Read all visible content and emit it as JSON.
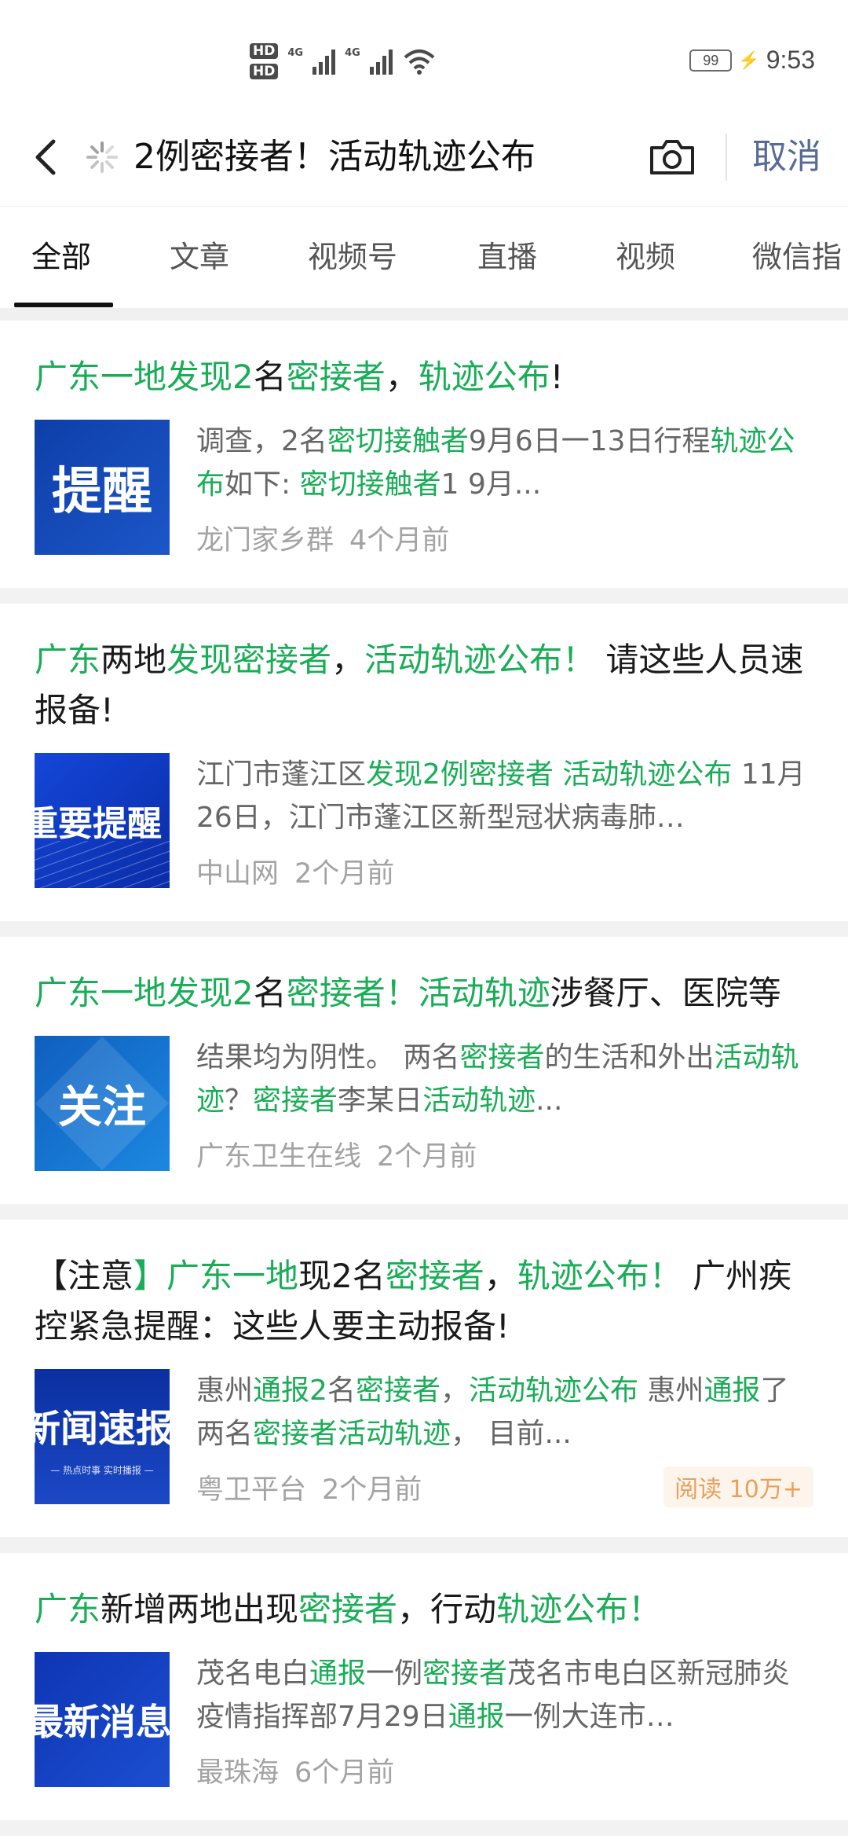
{
  "status": {
    "hd1": "HD",
    "hd2": "HD",
    "net1": "4G",
    "net2": "4G",
    "battery": "99",
    "time": "9:53"
  },
  "search": {
    "query": "2例密接者！活动轨迹公布",
    "cancel": "取消"
  },
  "tabs": [
    "全部",
    "文章",
    "视频号",
    "直播",
    "视频",
    "微信指"
  ],
  "colors": {
    "highlight": "#1aad57",
    "cancel": "#576b95",
    "read_badge": "#e7a05c"
  },
  "results": [
    {
      "title": [
        {
          "t": "广东一地发现2",
          "h": true
        },
        {
          "t": "名",
          "h": false
        },
        {
          "t": "密接者",
          "h": true
        },
        {
          "t": "，",
          "h": false
        },
        {
          "t": "轨迹公布",
          "h": true
        },
        {
          "t": "!",
          "h": false
        }
      ],
      "thumb_text": "提醒",
      "desc": [
        {
          "t": "调查，2名",
          "h": false
        },
        {
          "t": "密切接触者",
          "h": true
        },
        {
          "t": "9月6日一13日行程",
          "h": false
        },
        {
          "t": "轨迹公布",
          "h": true
        },
        {
          "t": "如下: ",
          "h": false
        },
        {
          "t": "密切接触者",
          "h": true
        },
        {
          "t": "1 9月...",
          "h": false
        }
      ],
      "source": "龙门家乡群",
      "ago": "4个月前"
    },
    {
      "title": [
        {
          "t": "广东",
          "h": true
        },
        {
          "t": "两地",
          "h": false
        },
        {
          "t": "发现密接者",
          "h": true
        },
        {
          "t": "，",
          "h": false
        },
        {
          "t": "活动轨迹公布！",
          "h": true
        },
        {
          "t": " 请这些人员速报备!",
          "h": false
        }
      ],
      "thumb_text": "重要提醒",
      "desc": [
        {
          "t": "江门市蓬江区",
          "h": false
        },
        {
          "t": "发现2例密接者 活动轨迹公布",
          "h": true
        },
        {
          "t": " 11月26日，江门市蓬江区新型冠状病毒肺…",
          "h": false
        }
      ],
      "source": "中山网",
      "ago": "2个月前"
    },
    {
      "title": [
        {
          "t": "广东一地发现2",
          "h": true
        },
        {
          "t": "名",
          "h": false
        },
        {
          "t": "密接者！活动轨迹",
          "h": true
        },
        {
          "t": "涉餐厅、医院等",
          "h": false
        }
      ],
      "thumb_text": "关注",
      "desc": [
        {
          "t": "结果均为阴性。 两名",
          "h": false
        },
        {
          "t": "密接者",
          "h": true
        },
        {
          "t": "的生活和外出",
          "h": false
        },
        {
          "t": "活动轨迹",
          "h": true
        },
        {
          "t": "？",
          "h": false
        },
        {
          "t": "密接者",
          "h": true
        },
        {
          "t": "李某日",
          "h": false
        },
        {
          "t": "活动轨迹",
          "h": true
        },
        {
          "t": "...",
          "h": false
        }
      ],
      "source": "广东卫生在线",
      "ago": "2个月前"
    },
    {
      "title": [
        {
          "t": "【注意",
          "h": false
        },
        {
          "t": "】广东一地",
          "h": true
        },
        {
          "t": "现2名",
          "h": false
        },
        {
          "t": "密接者",
          "h": true
        },
        {
          "t": "，",
          "h": false
        },
        {
          "t": "轨迹公布！",
          "h": true
        },
        {
          "t": " 广州疾控紧急提醒：这些人要主动报备!",
          "h": false
        }
      ],
      "thumb_text": "新闻速报",
      "thumb_sub": "— 热点时事 实时播报 —",
      "desc": [
        {
          "t": "惠州",
          "h": false
        },
        {
          "t": "通报2",
          "h": true
        },
        {
          "t": "名",
          "h": false
        },
        {
          "t": "密接者",
          "h": true
        },
        {
          "t": "，",
          "h": false
        },
        {
          "t": "活动轨迹公布",
          "h": true
        },
        {
          "t": " 惠州",
          "h": false
        },
        {
          "t": "通报",
          "h": true
        },
        {
          "t": "了两名",
          "h": false
        },
        {
          "t": "密接者活动轨迹",
          "h": true
        },
        {
          "t": "， 目前...",
          "h": false
        }
      ],
      "source": "粤卫平台",
      "ago": "2个月前",
      "read": "阅读 10万+"
    },
    {
      "title": [
        {
          "t": "广东",
          "h": true
        },
        {
          "t": "新增两地出现",
          "h": false
        },
        {
          "t": "密接者",
          "h": true
        },
        {
          "t": "，行动",
          "h": false
        },
        {
          "t": "轨迹公布！",
          "h": true
        }
      ],
      "thumb_text": "最新消息",
      "desc": [
        {
          "t": "茂名电白",
          "h": false
        },
        {
          "t": "通报",
          "h": true
        },
        {
          "t": "一例",
          "h": false
        },
        {
          "t": "密接者",
          "h": true
        },
        {
          "t": "茂名市电白区新冠肺炎疫情指挥部7月29日",
          "h": false
        },
        {
          "t": "通报",
          "h": true
        },
        {
          "t": "一例大连市…",
          "h": false
        }
      ],
      "source": "最珠海",
      "ago": "6个月前"
    }
  ]
}
